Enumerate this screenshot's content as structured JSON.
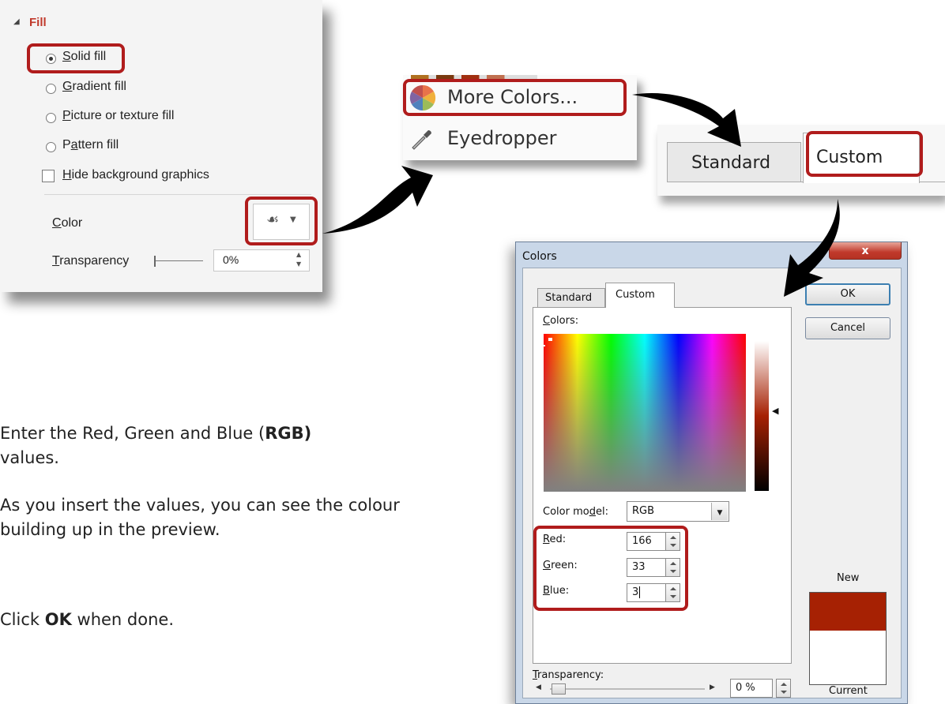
{
  "fill_panel": {
    "section_title": "Fill",
    "options": [
      {
        "label": "Solid fill",
        "key": "S",
        "rest": "olid fill",
        "selected": true
      },
      {
        "label": "Gradient fill",
        "key": "G",
        "rest": "radient fill",
        "selected": false
      },
      {
        "label": "Picture or texture fill",
        "key": "P",
        "rest": "icture or texture fill",
        "selected": false
      },
      {
        "label": "Pattern fill",
        "key_pre": "P",
        "key": "a",
        "rest": "ttern fill",
        "selected": false
      }
    ],
    "hide_bg": {
      "key": "H",
      "rest": "ide background graphics"
    },
    "color": {
      "key": "C",
      "rest": "olor"
    },
    "transparency": {
      "key": "T",
      "rest": "ransparency",
      "value": "0%"
    }
  },
  "menu": {
    "more_colors": "More Colors...",
    "eyedropper": "Eyedropper"
  },
  "tabs_zoom": {
    "standard": "Standard",
    "custom": "Custom"
  },
  "dialog": {
    "title": "Colors",
    "close": "x",
    "tabs": [
      "Standard",
      "Custom"
    ],
    "ok": "OK",
    "cancel": "Cancel",
    "colors_label": {
      "key": "C",
      "rest": "olors:"
    },
    "color_model": {
      "pre": "Color mo",
      "key": "d",
      "rest": "el:",
      "value": "RGB"
    },
    "red": {
      "key": "R",
      "rest": "ed:",
      "value": "166"
    },
    "green": {
      "key": "G",
      "rest": "reen:",
      "value": "33"
    },
    "blue": {
      "key": "B",
      "rest": "lue:",
      "value": "3"
    },
    "new_label": "New",
    "current_label": "Current",
    "transparency": {
      "key": "T",
      "rest": "ransparency:",
      "value": "0 %"
    },
    "new_color": "#a62103"
  },
  "instructions": {
    "p1_pre": "Enter the Red, Green and Blue (",
    "p1_bold": "RGB)",
    "p1_post": "values.",
    "p2": "As you insert the values, you can see the colour building up in the preview.",
    "p3_pre": "Click ",
    "p3_bold": "OK",
    "p3_post": " when done."
  },
  "colors": {
    "accent_red": "#b01c1c",
    "section_red": "#c0392b"
  }
}
